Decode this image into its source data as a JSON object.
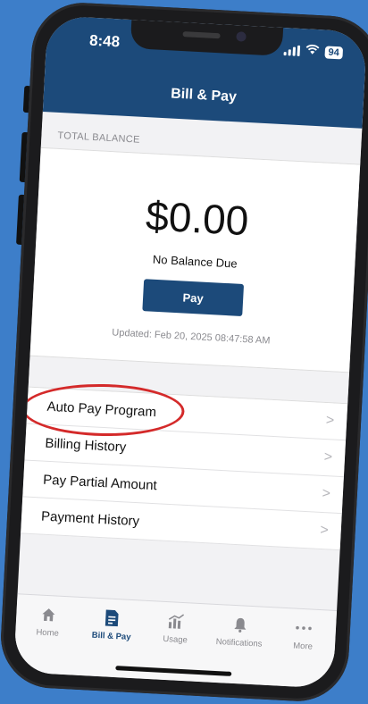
{
  "status_bar": {
    "time": "8:48",
    "battery": "94"
  },
  "header": {
    "title": "Bill & Pay"
  },
  "balance": {
    "section_label": "TOTAL BALANCE",
    "amount": "$0.00",
    "status": "No Balance Due",
    "pay_label": "Pay",
    "updated": "Updated: Feb 20, 2025 08:47:58 AM"
  },
  "menu": {
    "items": [
      {
        "label": "Auto Pay Program"
      },
      {
        "label": "Billing History"
      },
      {
        "label": "Pay Partial Amount"
      },
      {
        "label": "Payment History"
      }
    ],
    "chevron": ">",
    "highlighted_item": "Auto Pay Program",
    "highlight_color": "#d42a2a"
  },
  "tabs": [
    {
      "label": "Home",
      "icon": "home-icon"
    },
    {
      "label": "Bill & Pay",
      "icon": "bill-icon",
      "active": true
    },
    {
      "label": "Usage",
      "icon": "usage-icon"
    },
    {
      "label": "Notifications",
      "icon": "bell-icon"
    },
    {
      "label": "More",
      "icon": "more-icon"
    }
  ],
  "colors": {
    "brand": "#1c4a7a",
    "background": "#3d7ec9"
  }
}
